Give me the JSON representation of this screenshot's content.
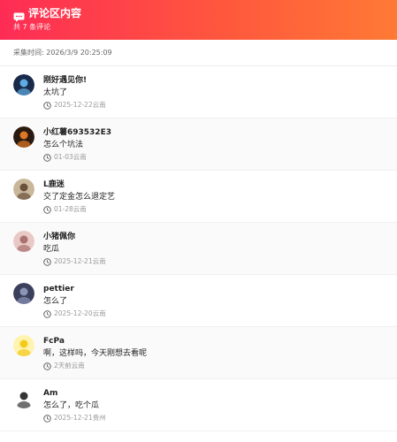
{
  "header": {
    "title": "评论区内容",
    "subtitle": "共 7 条评论",
    "icon": "comment-icon"
  },
  "collect_time": "采集时间: 2026/3/9 20:25:09",
  "comments": [
    {
      "author": "刚好遇见你!",
      "text": "太坑了",
      "time": "2025-12-22云南",
      "avatar_color": "#1a2a4a",
      "avatar_accent": "#6cc3ff"
    },
    {
      "author": "小红薯693532E3",
      "text": "怎么个坑法",
      "time": "01-03云南",
      "avatar_color": "#2b1a10",
      "avatar_accent": "#ff8a2a"
    },
    {
      "author": "L鹿迷",
      "text": "交了定金怎么退定艺",
      "time": "01-28云南",
      "avatar_color": "#c9b79a",
      "avatar_accent": "#5a3e2b"
    },
    {
      "author": "小猪佩你",
      "text": "吃瓜",
      "time": "2025-12-21云南",
      "avatar_color": "#e9c9c5",
      "avatar_accent": "#a06060"
    },
    {
      "author": "pettier",
      "text": "怎么了",
      "time": "2025-12-20云南",
      "avatar_color": "#3a3f5c",
      "avatar_accent": "#9aa3c7"
    },
    {
      "author": "FcPa",
      "text": "啊，这样吗，今天刚想去看呢",
      "time": "2天前云南",
      "avatar_color": "#fff3b0",
      "avatar_accent": "#f2c200"
    },
    {
      "author": "Am",
      "text": "怎么了，吃个瓜",
      "time": "2025-12-21贵州",
      "avatar_color": "#ffffff",
      "avatar_accent": "#111111"
    }
  ],
  "icons": {
    "time": "clock-icon"
  },
  "colors": {
    "brand_start": "#fe2c55",
    "brand_end": "#ff7a35"
  }
}
